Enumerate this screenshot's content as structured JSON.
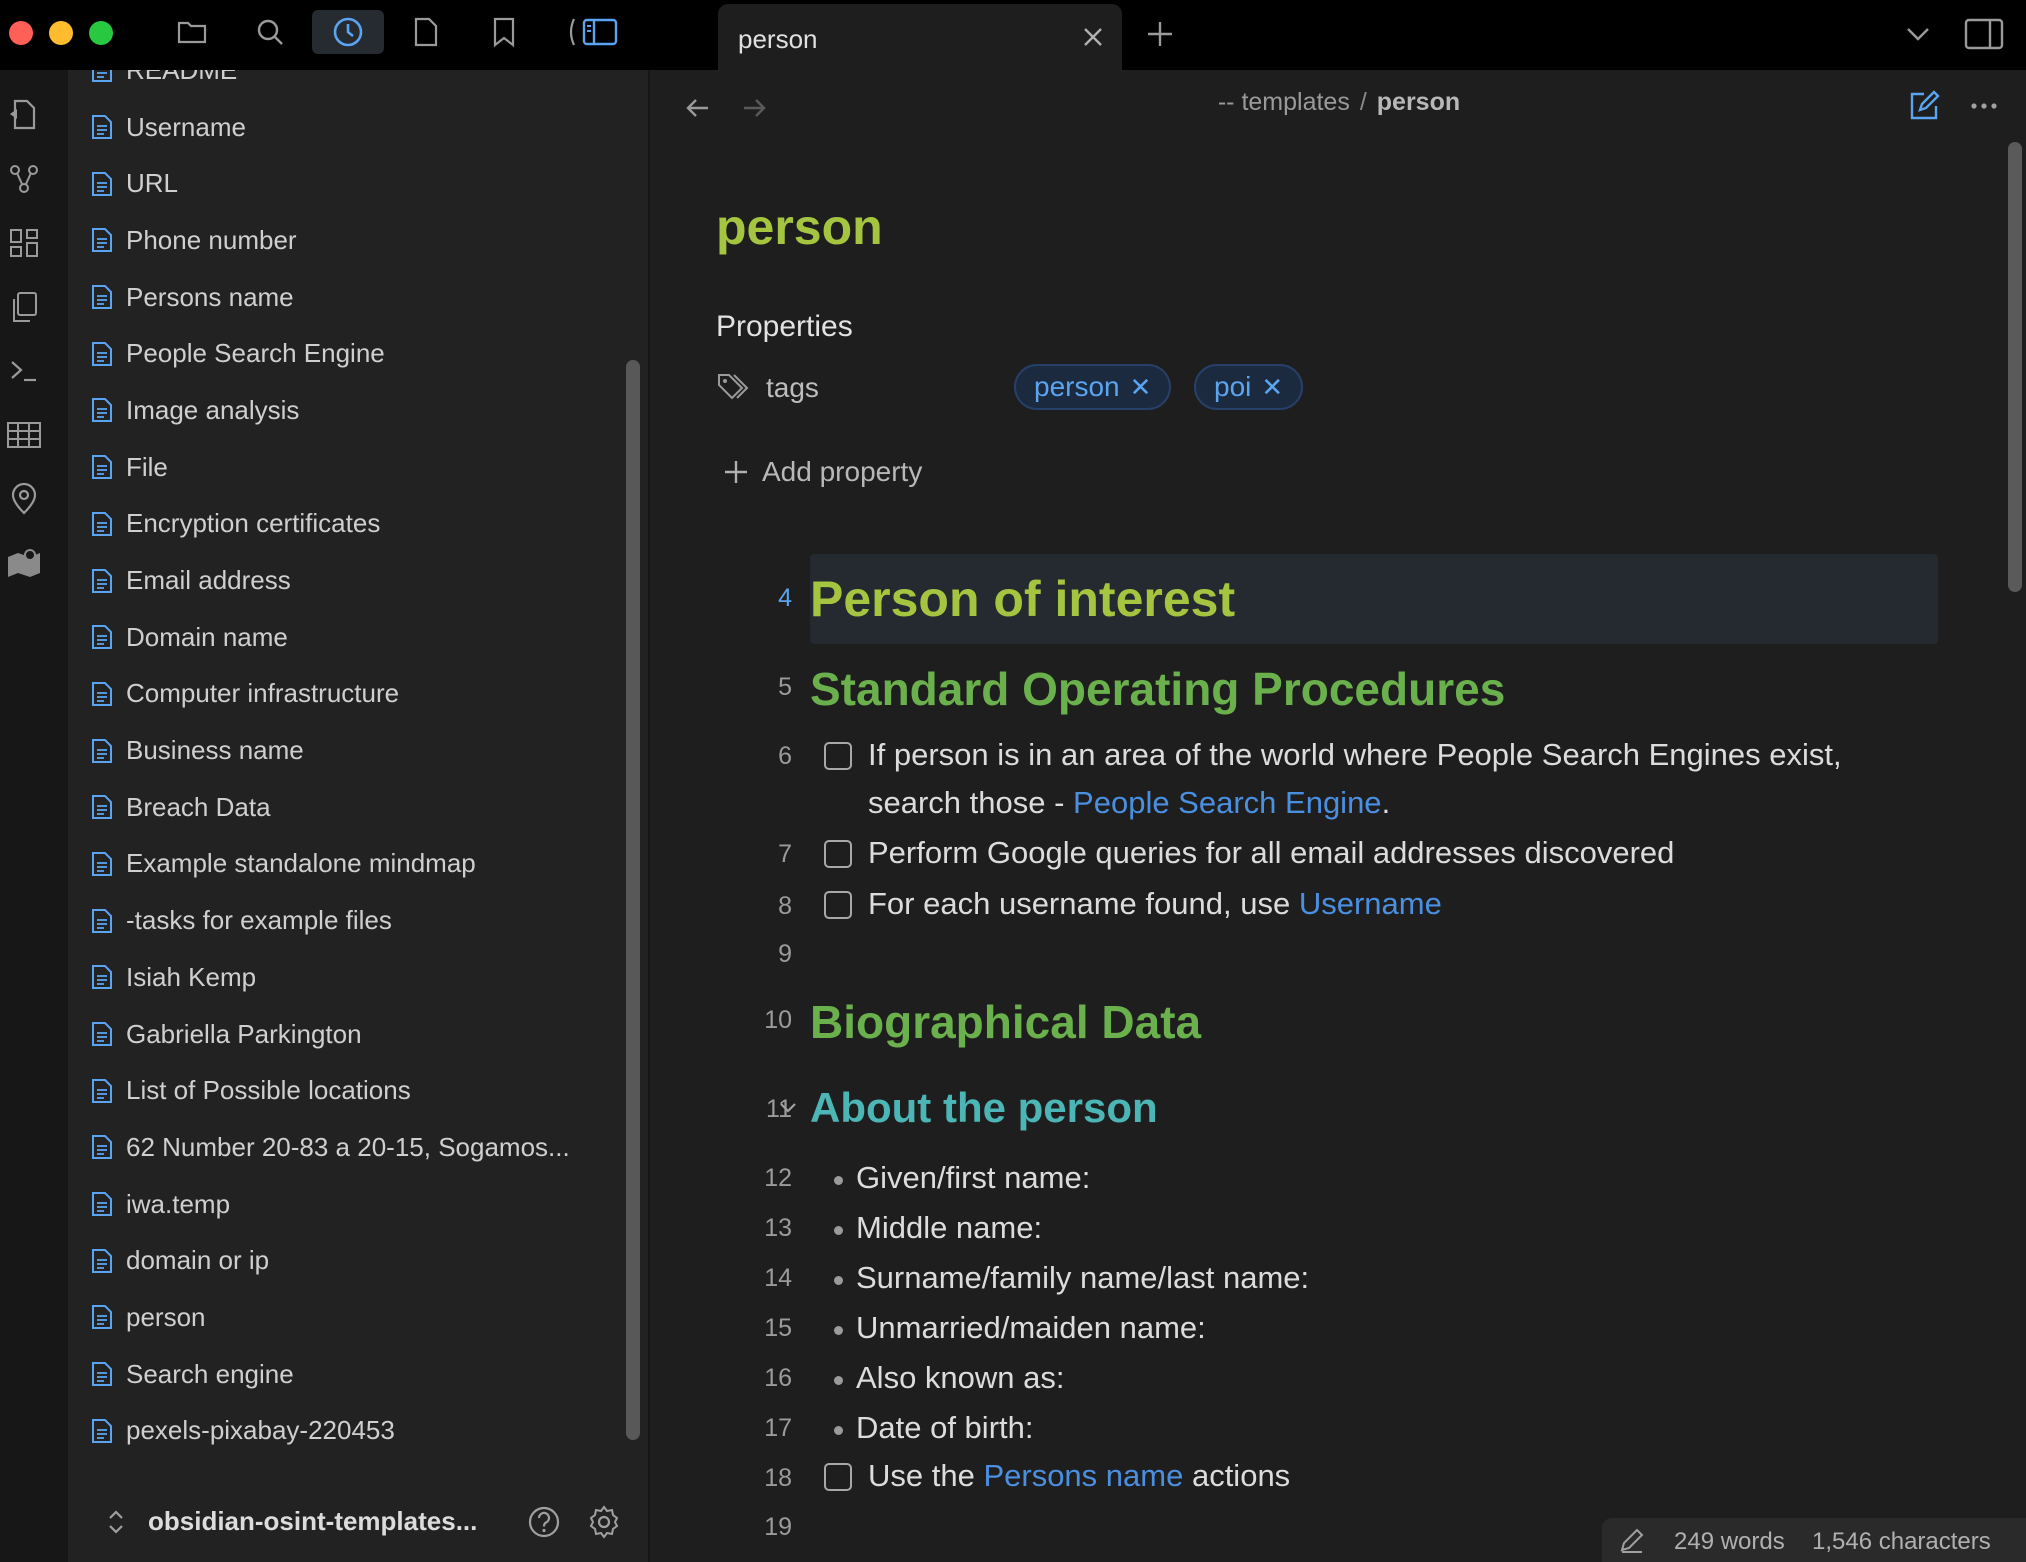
{
  "window": {
    "tab_title": "person"
  },
  "sidebar": {
    "files": [
      "README",
      "Username",
      "URL",
      "Phone number",
      "Persons name",
      "People Search Engine",
      "Image analysis",
      "File",
      "Encryption certificates",
      "Email address",
      "Domain name",
      "Computer infrastructure",
      "Business name",
      "Breach Data",
      "Example standalone mindmap",
      "-tasks for example files",
      "Isiah Kemp",
      "Gabriella Parkington",
      "List of Possible locations",
      "62 Number 20-83 a 20-15, Sogamos...",
      "iwa.temp",
      "domain or ip",
      "person",
      "Search engine",
      "pexels-pixabay-220453"
    ],
    "vault_name": "obsidian-osint-templates..."
  },
  "editor": {
    "breadcrumb": {
      "folder": "-- templates",
      "separator": "/",
      "current": "person"
    },
    "note_title": "person",
    "properties_heading": "Properties",
    "property": {
      "key": "tags",
      "tags": [
        "person",
        "poi"
      ]
    },
    "add_property_label": "Add property",
    "lines": {
      "l4": {
        "num": "4",
        "text": "Person of interest"
      },
      "l5": {
        "num": "5",
        "text": "Standard Operating Procedures"
      },
      "l6": {
        "num": "6",
        "text": "If person is in an area of the world where People Search Engines exist, search those - ",
        "link": "People Search Engine",
        "after": "."
      },
      "l7": {
        "num": "7",
        "text": "Perform Google queries for all email addresses discovered"
      },
      "l8": {
        "num": "8",
        "text": "For each username found, use ",
        "link": "Username"
      },
      "l9": {
        "num": "9"
      },
      "l10": {
        "num": "10",
        "text": "Biographical Data"
      },
      "l11": {
        "num": "11",
        "text": "About the person"
      },
      "l12": {
        "num": "12",
        "text": "Given/first name:"
      },
      "l13": {
        "num": "13",
        "text": "Middle name:"
      },
      "l14": {
        "num": "14",
        "text": "Surname/family name/last name:"
      },
      "l15": {
        "num": "15",
        "text": "Unmarried/maiden name:"
      },
      "l16": {
        "num": "16",
        "text": "Also known as:"
      },
      "l17": {
        "num": "17",
        "text": "Date of birth:"
      },
      "l18": {
        "num": "18",
        "text": "Use the ",
        "link": "Persons name",
        "after": " actions"
      },
      "l19": {
        "num": "19"
      }
    }
  },
  "statusbar": {
    "words": "249 words",
    "characters": "1,546 characters"
  },
  "colors": {
    "accent": "#5aa4f0",
    "h1": "#a5c43f",
    "h2": "#6ab04c",
    "h3": "#4cb5b5",
    "link": "#4a8fe0"
  }
}
